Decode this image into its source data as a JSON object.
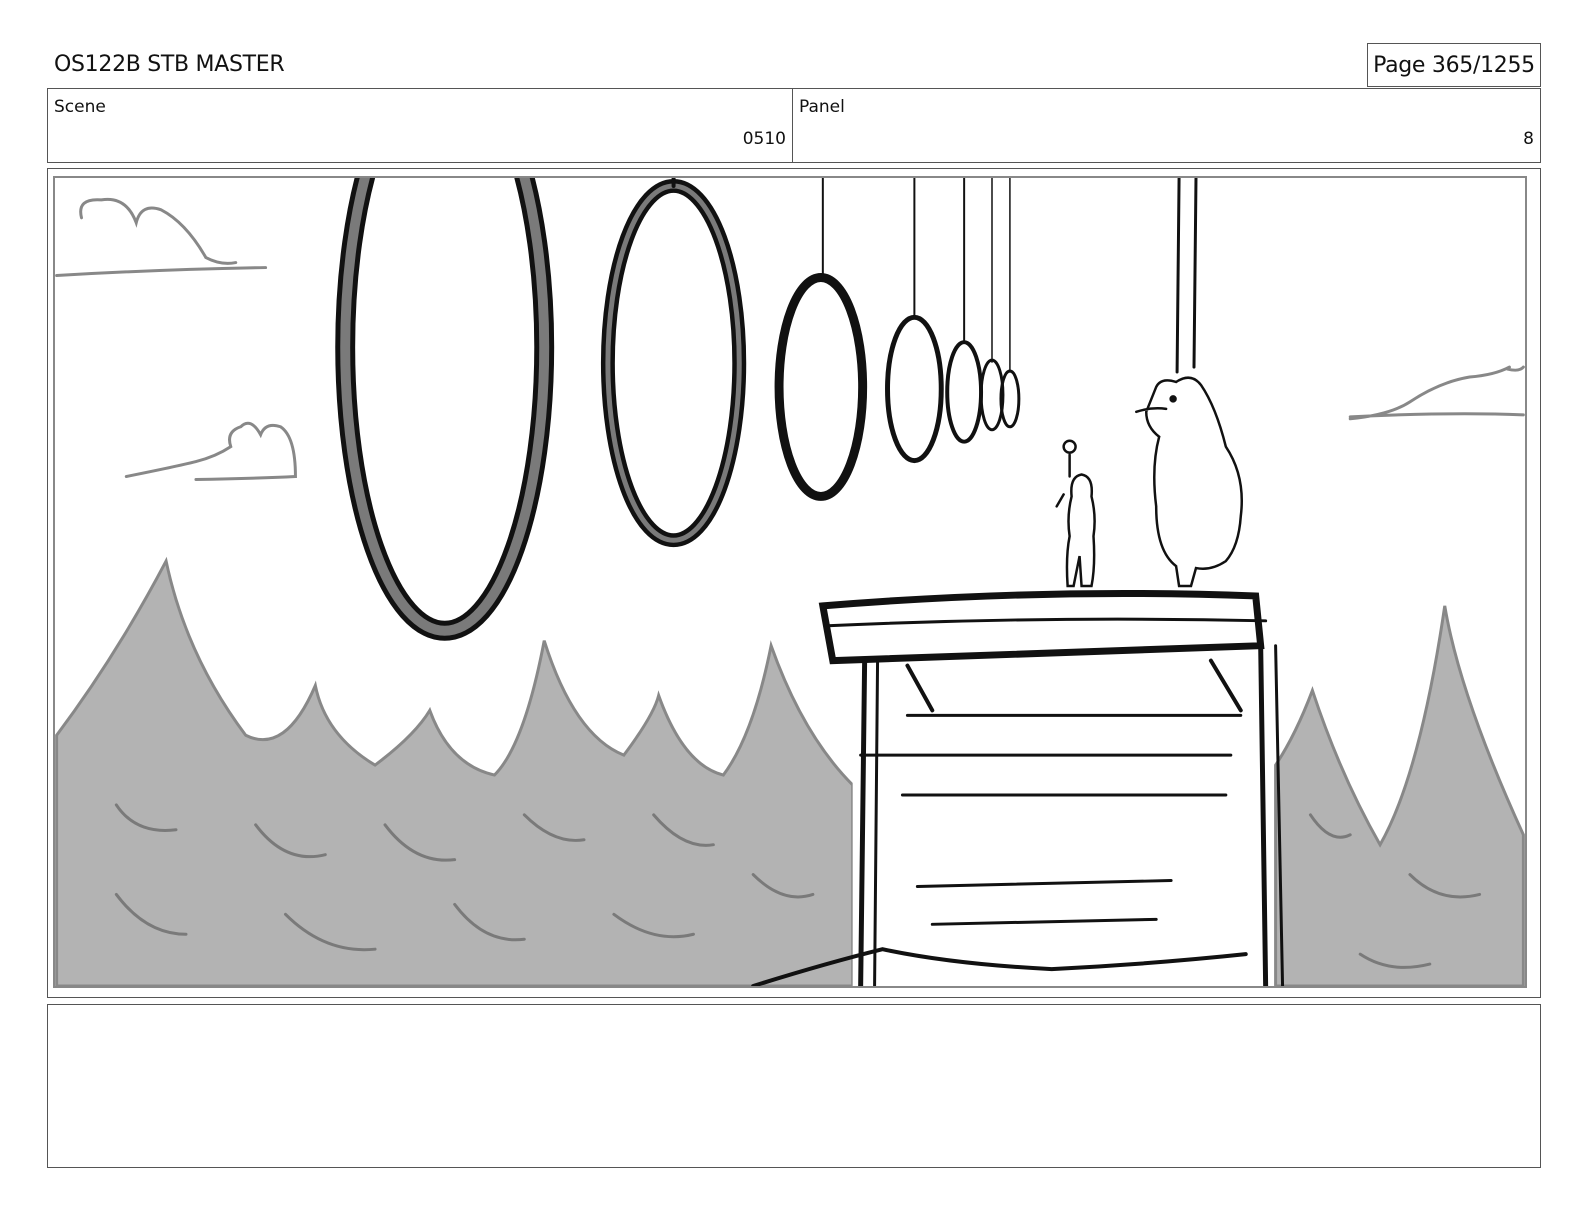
{
  "header": {
    "document_title": "OS122B STB MASTER",
    "page_label": "Page",
    "page_number": "365/1255"
  },
  "info": {
    "scene_label": "Scene",
    "scene_value": "0510",
    "panel_label": "Panel",
    "panel_value": "8"
  },
  "sketch": {
    "subject": "hanging-rings-over-forest-with-platform-and-two-characters",
    "colors": {
      "line": "#111111",
      "fill_gray": "#b3b3b3",
      "ring_fill": "#7a7a7a",
      "cloud_line": "#888888"
    }
  },
  "notes": {
    "text": ""
  }
}
